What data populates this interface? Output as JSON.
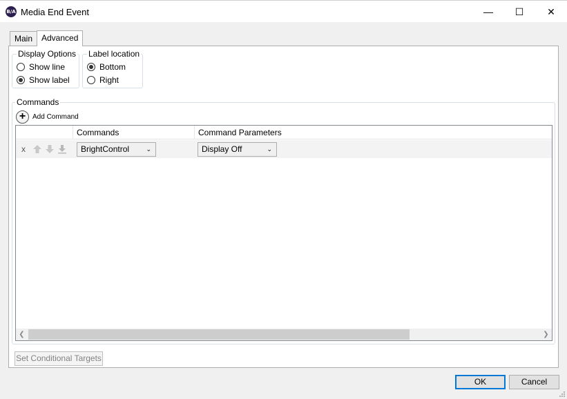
{
  "window": {
    "title": "Media End Event",
    "app_icon_text": "B/A",
    "controls": {
      "minimize": "—",
      "maximize": "☐",
      "close": "✕"
    }
  },
  "tabs": [
    {
      "label": "Main",
      "selected": false
    },
    {
      "label": "Advanced",
      "selected": true
    }
  ],
  "display_options": {
    "legend": "Display Options",
    "options": [
      {
        "label": "Show line",
        "checked": false
      },
      {
        "label": "Show label",
        "checked": true
      }
    ]
  },
  "label_location": {
    "legend": "Label location",
    "options": [
      {
        "label": "Bottom",
        "checked": true
      },
      {
        "label": "Right",
        "checked": false
      }
    ]
  },
  "commands": {
    "legend": "Commands",
    "add_label": "Add Command",
    "columns": [
      "Commands",
      "Command Parameters"
    ],
    "rows": [
      {
        "remove": "x",
        "command": "BrightControl",
        "parameter": "Display Off"
      }
    ]
  },
  "buttons": {
    "conditional_targets": "Set Conditional Targets",
    "ok": "OK",
    "cancel": "Cancel"
  }
}
